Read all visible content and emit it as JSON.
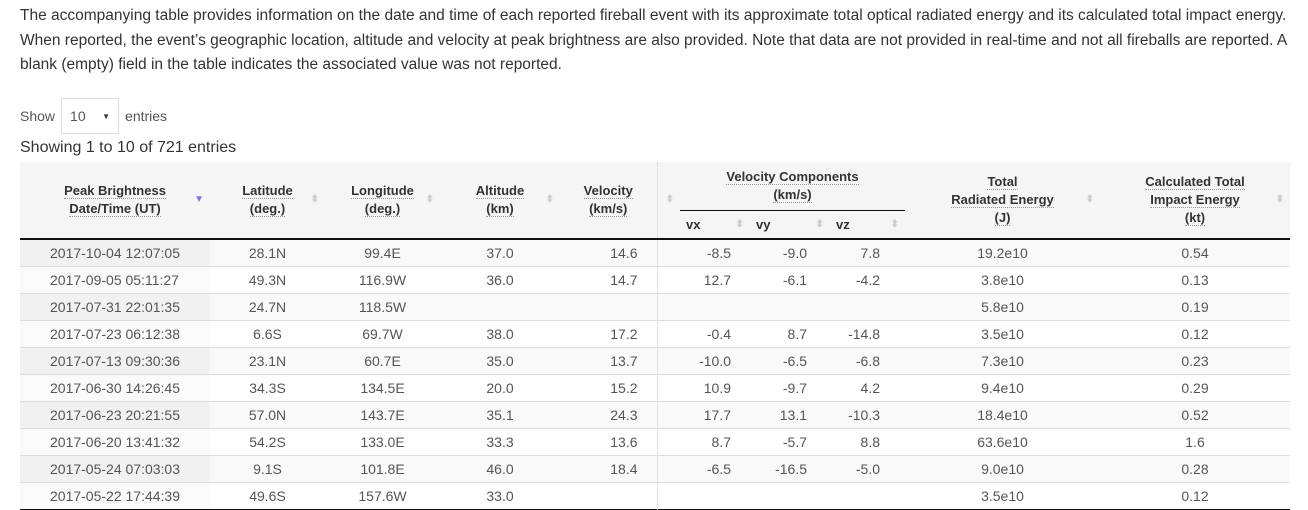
{
  "intro": "The accompanying table provides information on the date and time of each reported fireball event with its approximate total optical radiated energy and its calculated total impact energy. When reported, the event’s geographic location, altitude and velocity at peak brightness are also provided. Note that data are not provided in real-time and not all fireballs are reported. A blank (empty) field in the table indicates the associated value was not reported.",
  "length": {
    "show": "Show",
    "value": "10",
    "entries": "entries"
  },
  "info": "Showing 1 to 10 of 721 entries",
  "headers": {
    "date": [
      "Peak Brightness",
      "Date/Time (UT)"
    ],
    "lat": [
      "Latitude",
      "(deg.)"
    ],
    "lon": [
      "Longitude",
      "(deg.)"
    ],
    "alt": [
      "Altitude",
      "(km)"
    ],
    "vel": [
      "Velocity",
      "(km/s)"
    ],
    "vcomp": [
      "Velocity Components",
      "(km/s)"
    ],
    "vx": "vx",
    "vy": "vy",
    "vz": "vz",
    "rad": [
      "Total",
      "Radiated Energy",
      "(J)"
    ],
    "imp": [
      "Calculated Total",
      "Impact Energy",
      "(kt)"
    ]
  },
  "sort": {
    "column": "date",
    "direction": "descending"
  },
  "rows": [
    [
      "2017-10-04 12:07:05",
      "28.1N",
      "99.4E",
      "37.0",
      "14.6",
      "-8.5",
      "-9.0",
      "7.8",
      "19.2e10",
      "0.54"
    ],
    [
      "2017-09-05 05:11:27",
      "49.3N",
      "116.9W",
      "36.0",
      "14.7",
      "12.7",
      "-6.1",
      "-4.2",
      "3.8e10",
      "0.13"
    ],
    [
      "2017-07-31 22:01:35",
      "24.7N",
      "118.5W",
      "",
      "",
      "",
      "",
      "",
      "5.8e10",
      "0.19"
    ],
    [
      "2017-07-23 06:12:38",
      "6.6S",
      "69.7W",
      "38.0",
      "17.2",
      "-0.4",
      "8.7",
      "-14.8",
      "3.5e10",
      "0.12"
    ],
    [
      "2017-07-13 09:30:36",
      "23.1N",
      "60.7E",
      "35.0",
      "13.7",
      "-10.0",
      "-6.5",
      "-6.8",
      "7.3e10",
      "0.23"
    ],
    [
      "2017-06-30 14:26:45",
      "34.3S",
      "134.5E",
      "20.0",
      "15.2",
      "10.9",
      "-9.7",
      "4.2",
      "9.4e10",
      "0.29"
    ],
    [
      "2017-06-23 20:21:55",
      "57.0N",
      "143.7E",
      "35.1",
      "24.3",
      "17.7",
      "13.1",
      "-10.3",
      "18.4e10",
      "0.52"
    ],
    [
      "2017-06-20 13:41:32",
      "54.2S",
      "133.0E",
      "33.3",
      "13.6",
      "8.7",
      "-5.7",
      "8.8",
      "63.6e10",
      "1.6"
    ],
    [
      "2017-05-24 07:03:03",
      "9.1S",
      "101.8E",
      "46.0",
      "18.4",
      "-6.5",
      "-16.5",
      "-5.0",
      "9.0e10",
      "0.28"
    ],
    [
      "2017-05-22 17:44:39",
      "49.6S",
      "157.6W",
      "33.0",
      "",
      "",
      "",
      "",
      "3.5e10",
      "0.12"
    ]
  ]
}
